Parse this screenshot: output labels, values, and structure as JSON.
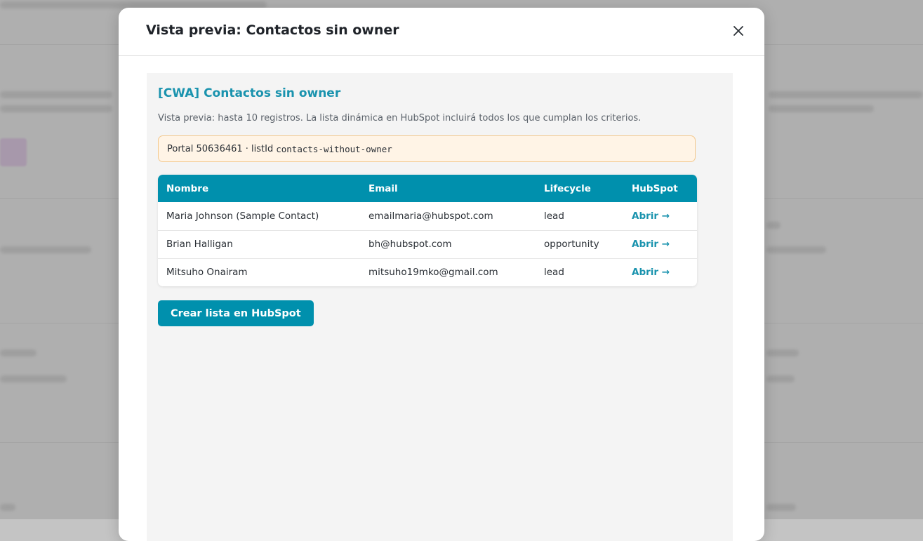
{
  "modal": {
    "title": "Vista previa: Contactos sin owner",
    "close_icon": "close-icon"
  },
  "preview": {
    "list_name": "[CWA] Contactos sin owner",
    "subtitle": "Vista previa: hasta 10 registros. La lista dinámica en HubSpot incluirá todos los que cumplan los criterios.",
    "info_prefix": "Portal 50636461 · listId",
    "list_id": "contacts-without-owner"
  },
  "table": {
    "headers": {
      "name": "Nombre",
      "email": "Email",
      "lifecycle": "Lifecycle",
      "hubspot": "HubSpot"
    },
    "rows": [
      {
        "name": "Maria Johnson (Sample Contact)",
        "email": "emailmaria@hubspot.com",
        "lifecycle": "lead",
        "link": "Abrir →"
      },
      {
        "name": "Brian Halligan",
        "email": "bh@hubspot.com",
        "lifecycle": "opportunity",
        "link": "Abrir →"
      },
      {
        "name": "Mitsuho Onairam",
        "email": "mitsuho19mko@gmail.com",
        "lifecycle": "lead",
        "link": "Abrir →"
      }
    ]
  },
  "actions": {
    "create_label": "Crear lista en HubSpot"
  },
  "colors": {
    "accent": "#0090ad",
    "title_accent": "#1a93ae",
    "info_bg": "#fff4e6",
    "info_border": "#f3c98f"
  }
}
